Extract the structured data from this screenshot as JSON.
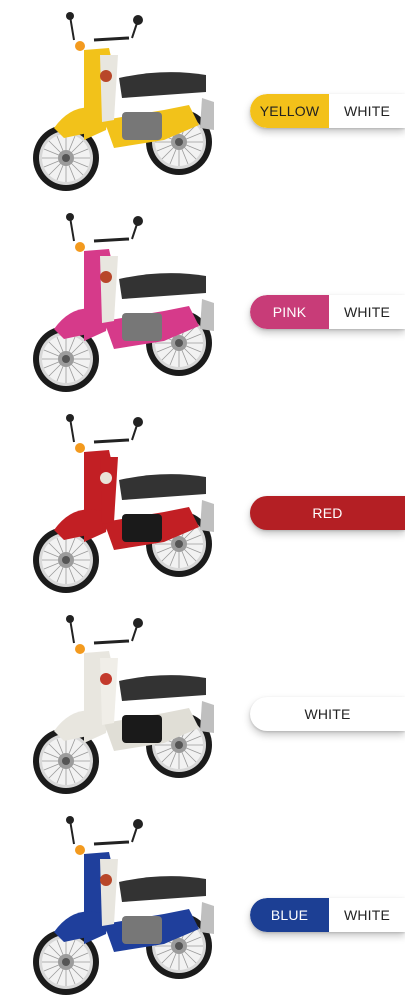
{
  "variants": [
    {
      "id": "yellow",
      "primary_label": "YELLOW",
      "secondary_label": "WHITE",
      "primary_color": "#f3c11a",
      "primary_text_color": "#222222",
      "body_color": "#f2c21a"
    },
    {
      "id": "pink",
      "primary_label": "PINK",
      "secondary_label": "WHITE",
      "primary_color": "#c83c78",
      "primary_text_color": "#ffffff",
      "body_color": "#d63a8a"
    },
    {
      "id": "red",
      "primary_label": "RED",
      "primary_color": "#b41f24",
      "primary_text_color": "#ffffff",
      "body_color": "#c21f24"
    },
    {
      "id": "white",
      "primary_label": "WHITE",
      "primary_color": "#ffffff",
      "primary_text_color": "#222222",
      "body_color": "#e8e6df"
    },
    {
      "id": "blue",
      "primary_label": "BLUE",
      "secondary_label": "WHITE",
      "primary_color": "#1c3f94",
      "primary_text_color": "#ffffff",
      "body_color": "#1f3f9c"
    }
  ]
}
